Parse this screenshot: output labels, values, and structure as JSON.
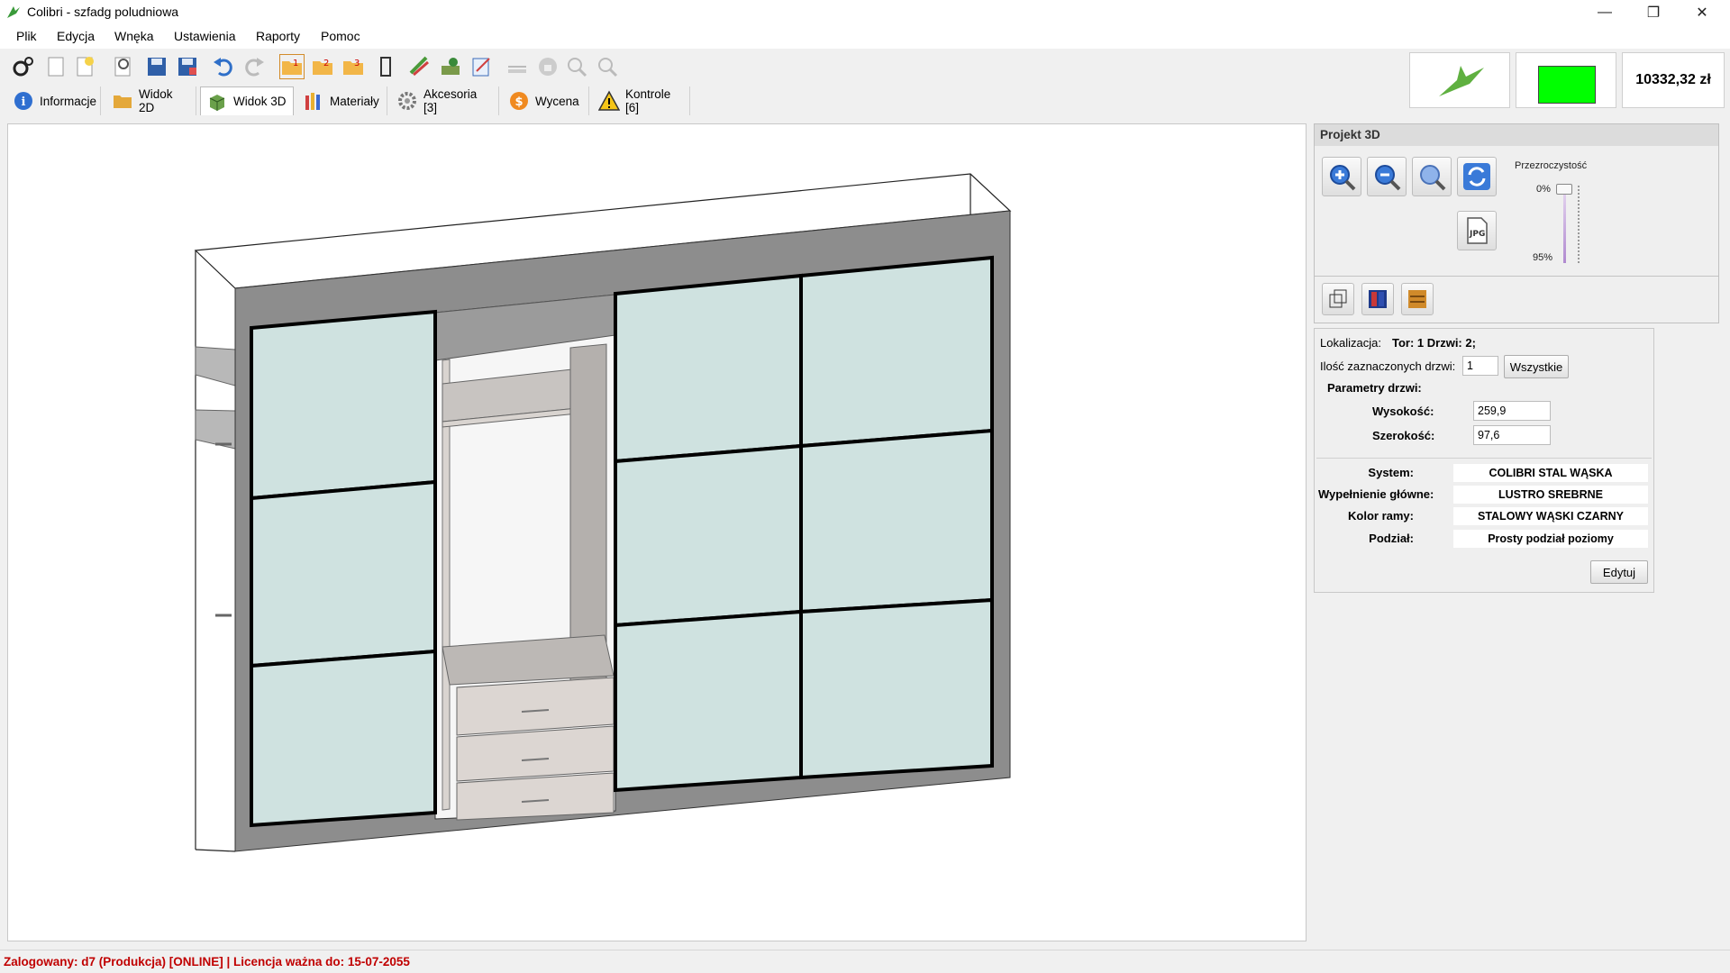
{
  "window": {
    "title": "Colibri - szfadg poludniowa"
  },
  "menu": [
    "Plik",
    "Edycja",
    "Wnęka",
    "Ustawienia",
    "Raporty",
    "Pomoc"
  ],
  "tabs": [
    {
      "label": "Informacje",
      "icon": "info-icon"
    },
    {
      "label": "Widok 2D",
      "icon": "folder-icon"
    },
    {
      "label": "Widok 3D",
      "icon": "cube-icon"
    },
    {
      "label": "Materiały",
      "icon": "materials-icon"
    },
    {
      "label": "Akcesoria [3]",
      "icon": "gear-icon"
    },
    {
      "label": "Wycena",
      "icon": "dollar-icon"
    },
    {
      "label": "Kontrole [6]",
      "icon": "warning-icon"
    }
  ],
  "price": "10332,32 zł",
  "status_color": "#00ff00",
  "project3d": {
    "title": "Projekt 3D",
    "transparency_label": "Przezroczystość",
    "transparency_min": "0%",
    "transparency_max": "95%"
  },
  "door": {
    "location_label": "Lokalizacja:",
    "location_value": "Tor: 1 Drzwi: 2;",
    "selected_label": "Ilość zaznaczonych drzwi:",
    "selected_value": "1",
    "all_button": "Wszystkie",
    "params_title": "Parametry drzwi:",
    "height_label": "Wysokość:",
    "height_value": "259,9",
    "width_label": "Szerokość:",
    "width_value": "97,6"
  },
  "params": {
    "system_label": "System:",
    "system_value": "COLIBRI STAL WĄSKA",
    "fill_label": "Wypełnienie główne:",
    "fill_value": "LUSTRO SREBRNE",
    "frame_label": "Kolor ramy:",
    "frame_value": "STALOWY WĄSKI CZARNY",
    "division_label": "Podział:",
    "division_value": "Prosty podział poziomy",
    "edit_button": "Edytuj"
  },
  "statusbar": "Zalogowany: d7 (Produkcja) [ONLINE] | Licencja ważna do: 15-07-2055"
}
